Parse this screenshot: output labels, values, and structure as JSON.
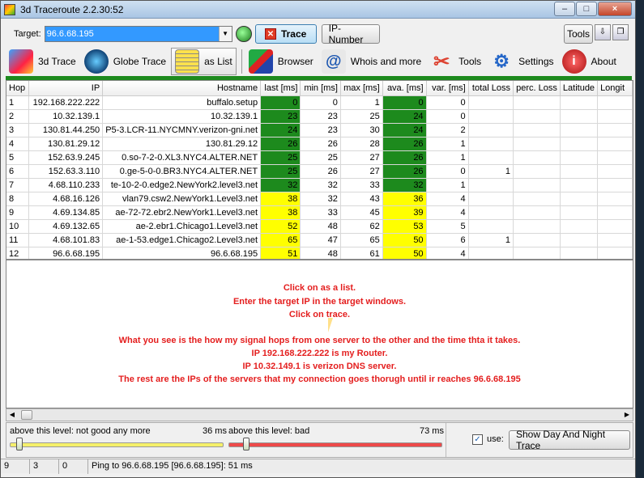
{
  "window": {
    "title": "3d Traceroute 2.2.30:52"
  },
  "top": {
    "target_label": "Target:",
    "target_value": "96.6.68.195",
    "trace_label": "Trace",
    "ip_number_label": "IP-Number",
    "tools_label": "Tools"
  },
  "toolbar": {
    "items": [
      {
        "label": "3d Trace",
        "icon": "3d-trace-icon"
      },
      {
        "label": "Globe Trace",
        "icon": "globe-icon"
      },
      {
        "label": "as List",
        "icon": "list-icon"
      },
      {
        "label": "Browser",
        "icon": "browser-icon"
      },
      {
        "label": "Whois and more",
        "icon": "whois-icon"
      },
      {
        "label": "Tools",
        "icon": "wrench-icon"
      },
      {
        "label": "Settings",
        "icon": "gears-icon"
      },
      {
        "label": "About",
        "icon": "info-icon"
      }
    ]
  },
  "table": {
    "headers": [
      "Hop",
      "IP",
      "Hostname",
      "last [ms]",
      "min [ms]",
      "max [ms]",
      "ava. [ms]",
      "var. [ms]",
      "total Loss",
      "perc. Loss",
      "Latitude",
      "Longit"
    ],
    "rows": [
      {
        "hop": "1",
        "ip": "192.168.222.222",
        "host": "buffalo.setup",
        "last": "0",
        "min": "0",
        "max": "1",
        "ava": "0",
        "var": "0",
        "loss": "",
        "color": "green"
      },
      {
        "hop": "2",
        "ip": "10.32.139.1",
        "host": "10.32.139.1",
        "last": "23",
        "min": "23",
        "max": "25",
        "ava": "24",
        "var": "0",
        "loss": "",
        "color": "green"
      },
      {
        "hop": "3",
        "ip": "130.81.44.250",
        "host": "P5-3.LCR-11.NYCMNY.verizon-gni.net",
        "last": "24",
        "min": "23",
        "max": "30",
        "ava": "24",
        "var": "2",
        "loss": "",
        "color": "green"
      },
      {
        "hop": "4",
        "ip": "130.81.29.12",
        "host": "130.81.29.12",
        "last": "26",
        "min": "26",
        "max": "28",
        "ava": "26",
        "var": "1",
        "loss": "",
        "color": "green"
      },
      {
        "hop": "5",
        "ip": "152.63.9.245",
        "host": "0.so-7-2-0.XL3.NYC4.ALTER.NET",
        "last": "25",
        "min": "25",
        "max": "27",
        "ava": "26",
        "var": "1",
        "loss": "",
        "color": "green"
      },
      {
        "hop": "6",
        "ip": "152.63.3.110",
        "host": "0.ge-5-0-0.BR3.NYC4.ALTER.NET",
        "last": "25",
        "min": "26",
        "max": "27",
        "ava": "26",
        "var": "0",
        "loss": "1",
        "color": "green"
      },
      {
        "hop": "7",
        "ip": "4.68.110.233",
        "host": "te-10-2-0.edge2.NewYork2.level3.net",
        "last": "32",
        "min": "32",
        "max": "33",
        "ava": "32",
        "var": "1",
        "loss": "",
        "color": "green"
      },
      {
        "hop": "8",
        "ip": "4.68.16.126",
        "host": "vlan79.csw2.NewYork1.Level3.net",
        "last": "38",
        "min": "32",
        "max": "43",
        "ava": "36",
        "var": "4",
        "loss": "",
        "color": "yellow"
      },
      {
        "hop": "9",
        "ip": "4.69.134.85",
        "host": "ae-72-72.ebr2.NewYork1.Level3.net",
        "last": "38",
        "min": "33",
        "max": "45",
        "ava": "39",
        "var": "4",
        "loss": "",
        "color": "yellow"
      },
      {
        "hop": "10",
        "ip": "4.69.132.65",
        "host": "ae-2.ebr1.Chicago1.Level3.net",
        "last": "52",
        "min": "48",
        "max": "62",
        "ava": "53",
        "var": "5",
        "loss": "",
        "color": "yellow"
      },
      {
        "hop": "11",
        "ip": "4.68.101.83",
        "host": "ae-1-53.edge1.Chicago2.Level3.net",
        "last": "65",
        "min": "47",
        "max": "65",
        "ava": "50",
        "var": "6",
        "loss": "1",
        "color": "yellow"
      },
      {
        "hop": "12",
        "ip": "96.6.68.195",
        "host": "96.6.68.195",
        "last": "51",
        "min": "48",
        "max": "61",
        "ava": "50",
        "var": "4",
        "loss": "",
        "color": "yellow"
      }
    ]
  },
  "info": {
    "lines": [
      "Click on as a list.",
      "Enter the target IP in the target windows.",
      "Click on trace.",
      "",
      "What you see is the how my signal hops from one server to the other and the time thta it takes.",
      "IP 192.168.222.222 is my Router.",
      "IP 10.32.149.1 is verizon DNS server.",
      "The rest are the IPs of the servers that my connection goes thorugh until ir reaches 96.6.68.195"
    ]
  },
  "thresholds": {
    "good_label": "above this level: not good any more",
    "good_value": "36 ms",
    "bad_label": "above this level: bad",
    "bad_value": "73 ms",
    "use_label": "use:",
    "use_checked": "✓",
    "day_night_label": "Show Day And Night Trace"
  },
  "status": {
    "cells": [
      "9",
      "3",
      "0"
    ],
    "message": "Ping to 96.6.68.195 [96.6.68.195]: 51 ms"
  },
  "colors": {
    "good": "#1d8a1d",
    "warn": "#ffff00",
    "info_text": "#e41e1e"
  }
}
